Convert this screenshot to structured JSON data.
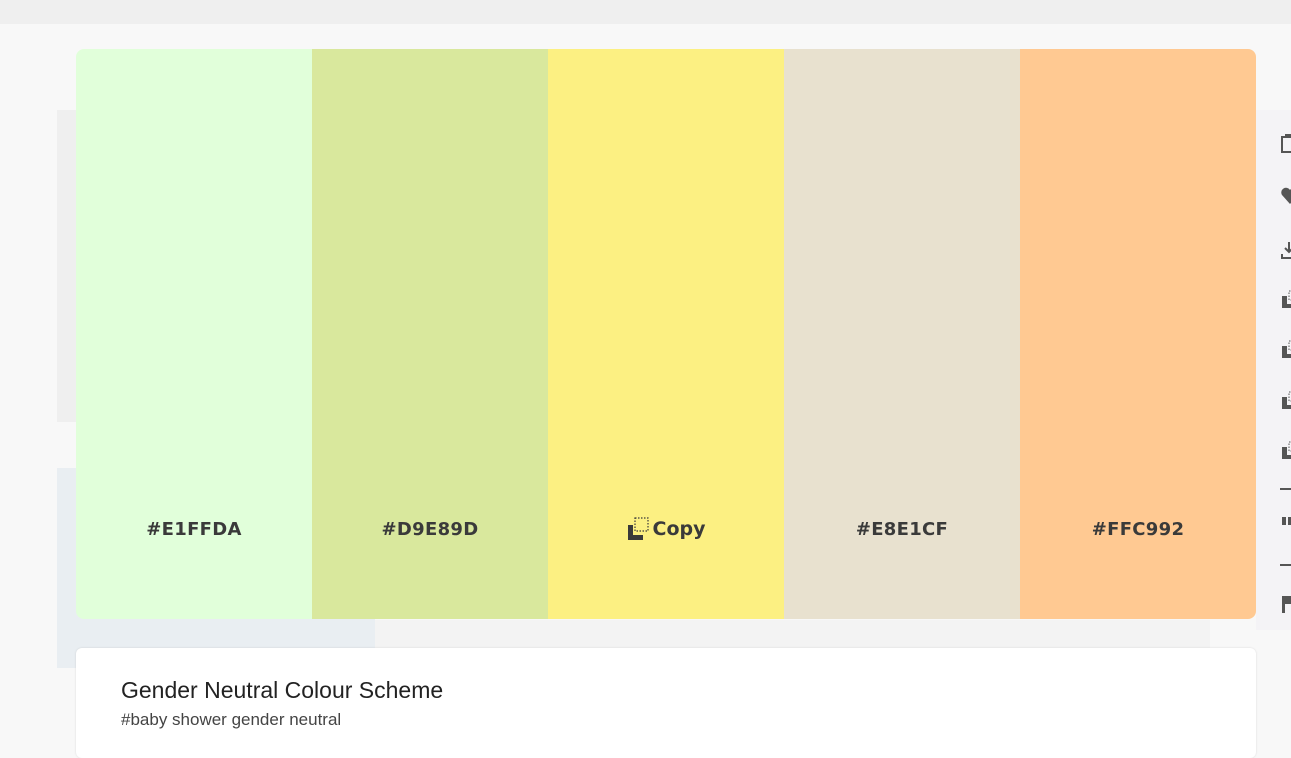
{
  "palette": {
    "swatches": [
      {
        "hex": "#E1FFDA",
        "label": "#E1FFDA"
      },
      {
        "hex": "#D9E89D",
        "label": "#D9E89D"
      },
      {
        "hex": "#FCF082",
        "label": "Copy"
      },
      {
        "hex": "#E8E1CF",
        "label": "#E8E1CF"
      },
      {
        "hex": "#FFC992",
        "label": "#FFC992"
      }
    ]
  },
  "scheme": {
    "title": "Gender Neutral Colour Scheme",
    "tags": "#baby shower gender neutral"
  },
  "icons": {
    "copy": "copy-icon",
    "tools": [
      "copy-icon",
      "heart-icon",
      "download-icon",
      "color-code-icon",
      "color-code-icon",
      "color-code-icon",
      "color-code-icon",
      "quote-icon",
      "flag-icon"
    ]
  }
}
